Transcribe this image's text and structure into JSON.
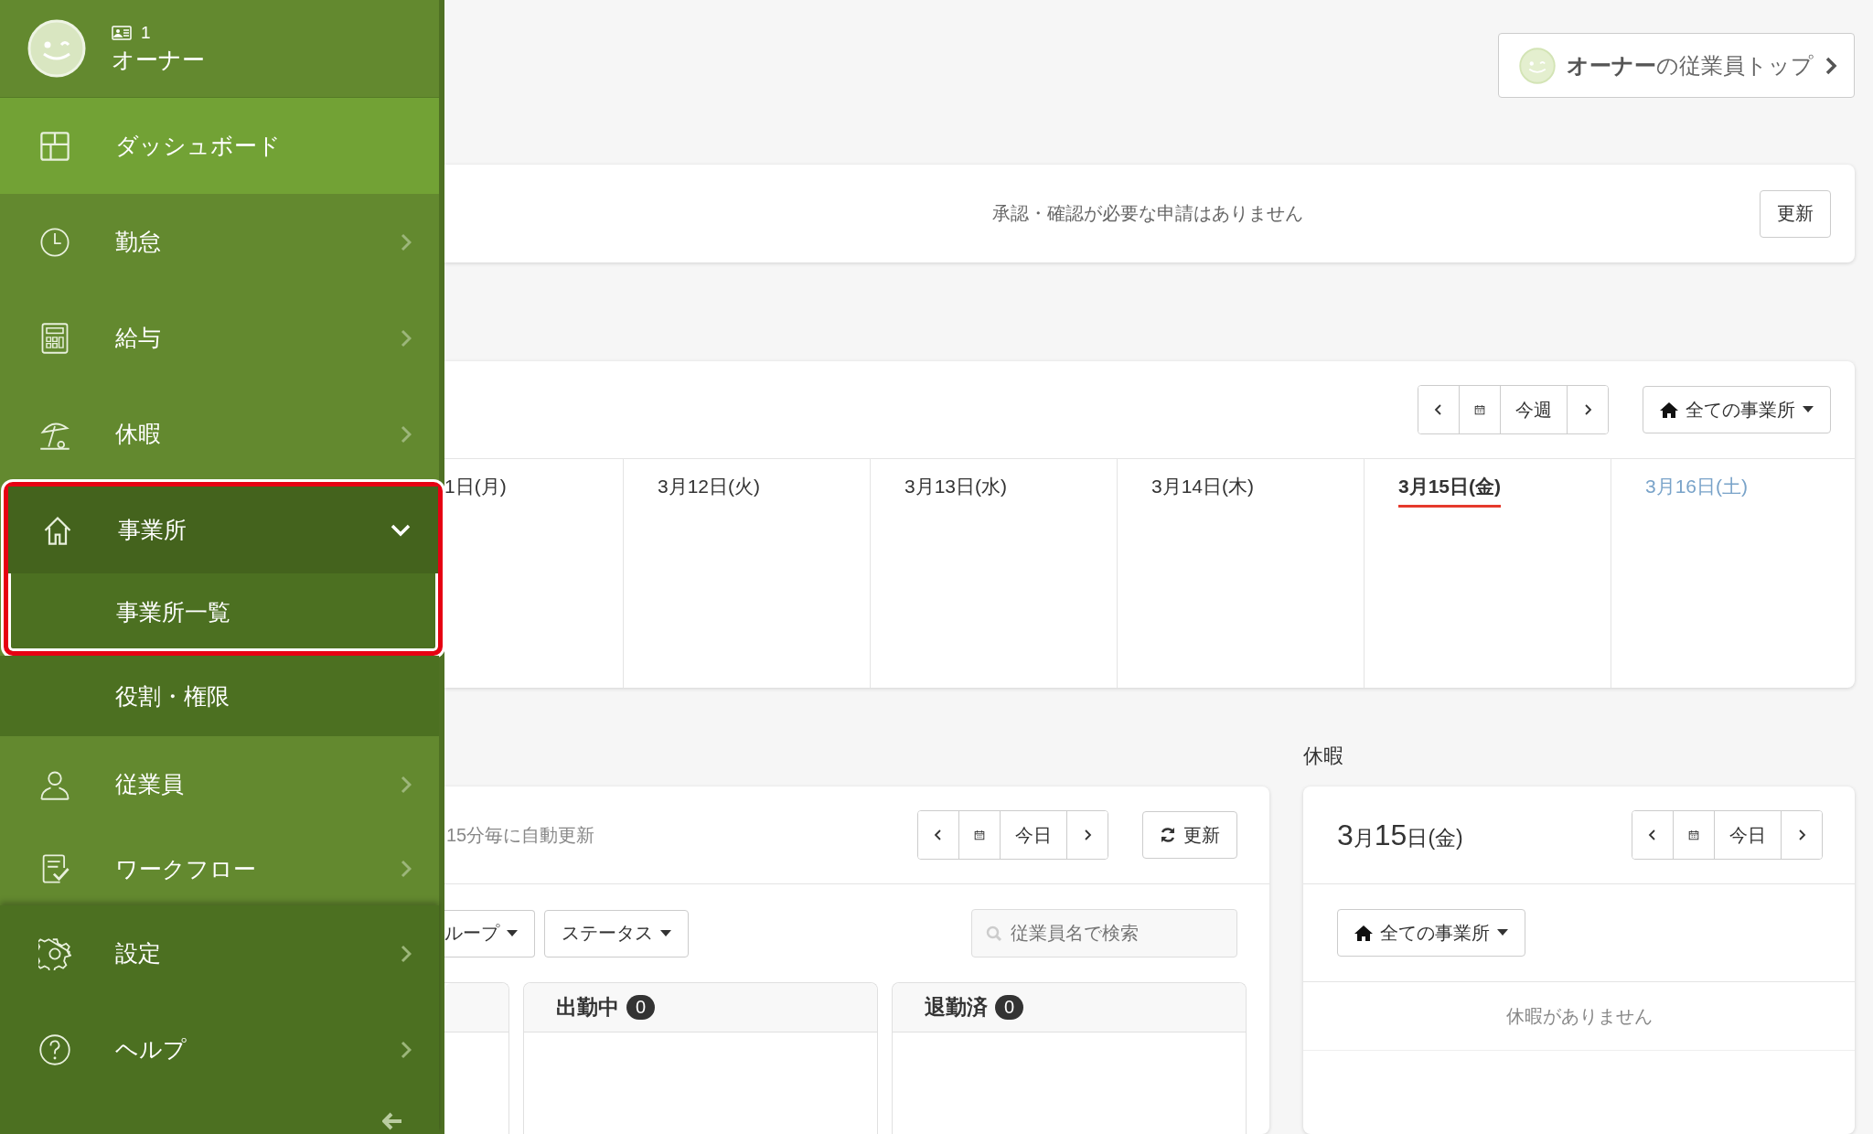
{
  "user": {
    "id": "1",
    "name": "オーナー"
  },
  "sidebar": {
    "items": [
      {
        "label": "ダッシュボード",
        "kind": "link",
        "selected": true
      },
      {
        "label": "勤怠",
        "kind": "group",
        "selected": false,
        "expanded": false
      },
      {
        "label": "給与",
        "kind": "group",
        "selected": false,
        "expanded": false
      },
      {
        "label": "休暇",
        "kind": "group",
        "selected": false,
        "expanded": false
      },
      {
        "label": "事業所",
        "kind": "group",
        "selected": false,
        "expanded": true,
        "highlighted": true,
        "children": [
          {
            "label": "事業所一覧",
            "selected": false,
            "highlighted": true
          },
          {
            "label": "役割・権限",
            "selected": false,
            "highlighted": false
          }
        ]
      },
      {
        "label": "従業員",
        "kind": "group",
        "selected": false,
        "expanded": false
      },
      {
        "label": "ワークフロー",
        "kind": "group",
        "selected": false,
        "expanded": false
      }
    ],
    "footer_items": [
      {
        "label": "設定",
        "kind": "group",
        "selected": false,
        "expanded": false
      },
      {
        "label": "ヘルプ",
        "kind": "group",
        "selected": false,
        "expanded": false
      }
    ]
  },
  "owner_top_button": "**オーナー**の従業員トップ",
  "approvals": {
    "message": "承認・確認が必要な申請はありません",
    "refresh": "更新"
  },
  "week": {
    "nav_label": "今週",
    "office_filter": "全ての事業所",
    "days": [
      {
        "label": "1日(月)",
        "today": false,
        "kind": "weekday"
      },
      {
        "label": "3月12日(火)",
        "today": false,
        "kind": "weekday"
      },
      {
        "label": "3月13日(水)",
        "today": false,
        "kind": "weekday"
      },
      {
        "label": "3月14日(木)",
        "today": false,
        "kind": "weekday"
      },
      {
        "label": "3月15日(金)",
        "today": true,
        "kind": "weekday"
      },
      {
        "label": "3月16日(土)",
        "today": false,
        "kind": "saturday"
      }
    ]
  },
  "attendance": {
    "note": "15分毎に自動更新",
    "nav_label": "今日",
    "refresh": "更新",
    "filters": [
      "ループ",
      "ステータス"
    ],
    "search": {
      "placeholder": "従業員名で検索"
    },
    "columns": [
      {
        "title": "出勤中",
        "count": "0"
      },
      {
        "title": "退勤済",
        "count": "0"
      }
    ]
  },
  "leave": {
    "heading": "休暇",
    "date": "3月15日(金)",
    "nav_label": "今日",
    "office_filter": "全ての事業所",
    "empty": "休暇がありません"
  }
}
